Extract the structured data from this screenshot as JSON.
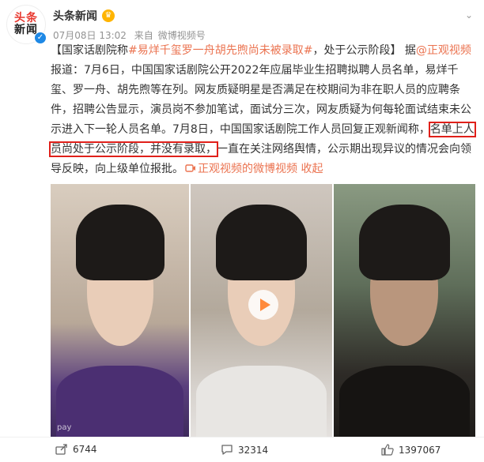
{
  "header": {
    "avatar_line1": "头条",
    "avatar_line2": "新闻",
    "account_name": "头条新闻",
    "date": "07月08日 13:02",
    "from_label": "来自",
    "source": "微博视频号"
  },
  "post": {
    "p1": "【国家话剧院称",
    "topic": "#易烊千玺罗一舟胡先煦尚未被录取#",
    "p2": "，处于公示阶段】 据",
    "mention": "@正观视频",
    "p3": "报道：7月6日，中国国家话剧院公开2022年应届毕业生招聘拟聘人员名单，易烊千玺、罗一舟、胡先煦等在列。网友质疑明星是否满足在校期间为非在职人员的应聘条件，招聘公告显示，演员岗不参加笔试，面试分三次，网友质疑为何每轮面试结束未公示进入下一轮人员名单。7月8日，中国国家话剧院工作人员回复正观新闻称，",
    "highlight": "名单上人员尚处于公示阶段，并没有录取，",
    "p4": "一直在关注网络舆情，公示期出现异议的情况会向领导反映，向上级单位报批。",
    "video_link": "正观视频的微博视频",
    "collapse_label": "收起"
  },
  "media": {
    "watermark": "pay"
  },
  "actions": {
    "shares": "6744",
    "comments": "32314",
    "likes": "1397067"
  },
  "icons": {
    "share": "share-icon",
    "comment": "comment-icon",
    "like": "like-icon",
    "chevron": "chevron-down-icon",
    "play": "play-icon"
  },
  "colors": {
    "accent": "#eb7350",
    "highlight_border": "#e0201a",
    "link_blue": "#1d7fc9"
  }
}
